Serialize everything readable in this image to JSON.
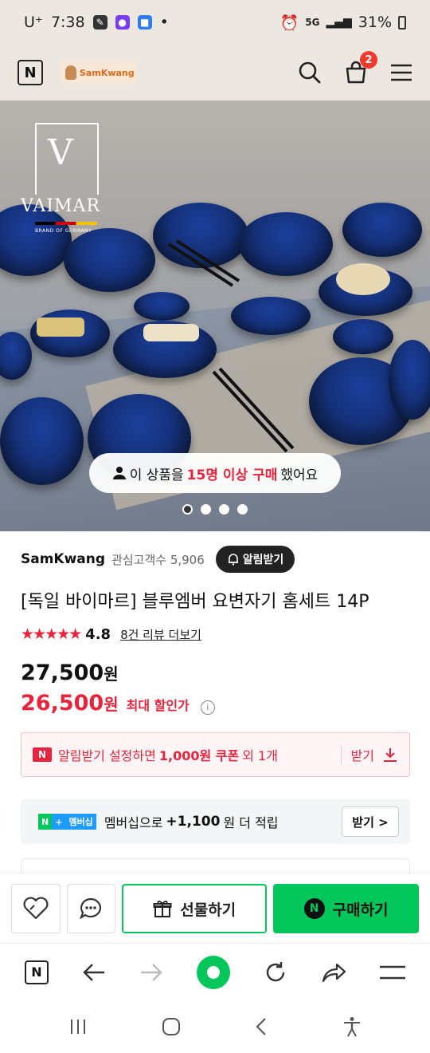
{
  "status_bar": {
    "carrier": "U⁺",
    "time": "7:38",
    "dot": "•",
    "network": "5G",
    "battery": "31%"
  },
  "header": {
    "brand_logo_text": "SamKwang",
    "cart_count": "2"
  },
  "hero": {
    "logo_brand": "VAIMAR",
    "logo_sub": "BRAND OF GERMANY",
    "buyers_prefix": "이 상품을",
    "buyers_highlight": "15명 이상 구매",
    "buyers_suffix": "했어요",
    "slide_count": 4,
    "active_slide": 1
  },
  "product": {
    "seller_name": "SamKwang",
    "watchers": "관심고객수 5,906",
    "alarm_button": "알림받기",
    "title": "[독일 바이마르] 블루엠버 요변자기 홈세트 14P",
    "stars": "★★★★★",
    "rating": "4.8",
    "reviews_link": "8건 리뷰 더보기",
    "original_price": "27,500",
    "sale_price": "26,500",
    "currency": "원",
    "sale_label": "최대 할인가",
    "info_icon": "i"
  },
  "coupon": {
    "badge": "N",
    "text_prefix": "알림받기 설정하면",
    "amount": "1,000원 쿠폰",
    "text_suffix": "외 1개",
    "get_label": "받기"
  },
  "membership": {
    "badge_n": "N",
    "badge_plus": "+",
    "badge_label": "멤버십",
    "text_prefix": "멤버십으로",
    "amount": "+1,100",
    "text_suffix": "원 더 적립",
    "get_label": "받기 >"
  },
  "buy_bar": {
    "gift_label": "선물하기",
    "buy_label": "구매하기",
    "buy_badge": "N"
  },
  "colors": {
    "accent_red": "#e8233b",
    "naver_green": "#03c75a"
  }
}
